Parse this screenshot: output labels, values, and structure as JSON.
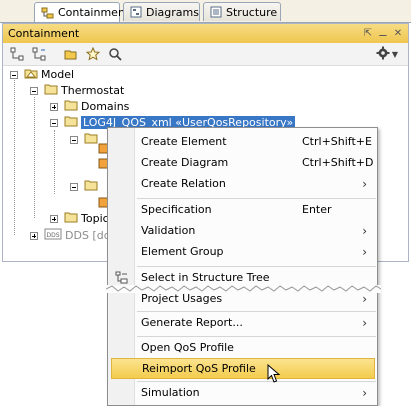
{
  "tabs": [
    {
      "label": "Containment",
      "icon": "containment-icon",
      "active": true
    },
    {
      "label": "Diagrams",
      "icon": "diagrams-icon",
      "active": false
    },
    {
      "label": "Structure",
      "icon": "structure-icon",
      "active": false
    }
  ],
  "panel": {
    "title": "Containment"
  },
  "tree": {
    "model": "Model",
    "thermostat": "Thermostat",
    "domains": "Domains",
    "selected": "LOG4J_QOS_xml «UserQosRepository»",
    "topic_partial": "Topic",
    "dds_partial": "DDS [dds"
  },
  "menu": {
    "items": [
      {
        "label": "Create Element",
        "shortcut": "Ctrl+Shift+E"
      },
      {
        "label": "Create Diagram",
        "shortcut": "Ctrl+Shift+D"
      },
      {
        "label": "Create Relation",
        "submenu": true
      },
      {
        "label": "Specification",
        "shortcut": "Enter"
      },
      {
        "label": "Validation",
        "submenu": true
      },
      {
        "label": "Element Group",
        "submenu": true
      },
      {
        "label": "Select in Structure Tree"
      },
      {
        "label": "Project Usages",
        "submenu": true
      },
      {
        "label": "Generate Report...",
        "submenu": true
      },
      {
        "label": "Open QoS Profile"
      },
      {
        "label": "Reimport QoS Profile",
        "highlighted": true
      },
      {
        "label": "Simulation",
        "submenu": true
      }
    ]
  },
  "colors": {
    "accent": "#efc64f",
    "selection": "#3876c6",
    "highlight": "#f3cc4e"
  }
}
